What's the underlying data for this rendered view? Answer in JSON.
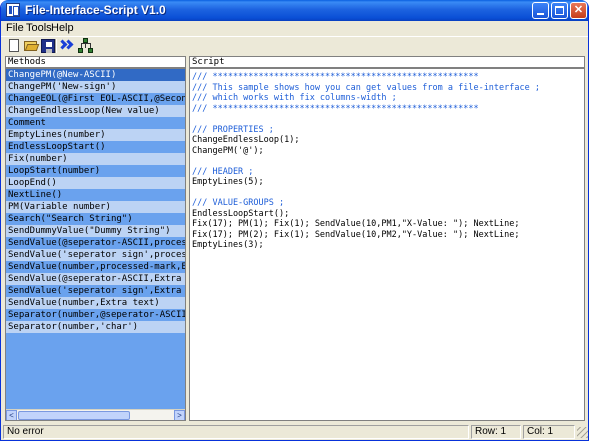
{
  "window": {
    "title": "File-Interface-Script V1.0",
    "titlebar_buttons": [
      "minimize",
      "maximize",
      "close"
    ],
    "close_glyph": "✕"
  },
  "menu": [
    "File",
    "Tools",
    "Help"
  ],
  "toolbar": {
    "tools": [
      "new-file-icon",
      "open-folder-icon",
      "save-disk-icon",
      "double-chevron-right-icon",
      "network-tree-icon"
    ]
  },
  "methods": {
    "header": "Methods",
    "items": [
      "ChangePM(@New-ASCII)",
      "ChangePM('New-sign')",
      "ChangeEOL(@First EOL-ASCII,@Secon",
      "ChangeEndlessLoop(New value)",
      "Comment",
      "EmptyLines(number)",
      "EndlessLoopStart()",
      "Fix(number)",
      "LoopStart(number)",
      "LoopEnd()",
      "NextLine()",
      "PM(Variable number)",
      "Search(\"Search String\")",
      "SendDummyValue(\"Dummy String\")",
      "SendValue(@seperator-ASCII,proces",
      "SendValue('seperator sign',proces",
      "SendValue(number,processed-mark,E",
      "SendValue(@seperator-ASCII,Extra",
      "SendValue('seperator sign',Extra",
      "SendValue(number,Extra text)",
      "Separator(number,@seperator-ASCII",
      "Separator(number,'char')"
    ],
    "selected_index": 0,
    "scroll_arrows": {
      "left": "<",
      "right": ">"
    }
  },
  "script": {
    "header": "Script",
    "lines": [
      {
        "text": "/// ****************************************************",
        "kind": "comment"
      },
      {
        "text": "/// This sample shows how you can get values from a file-interface ;",
        "kind": "comment"
      },
      {
        "text": "/// which works with fix columns-width ;",
        "kind": "comment"
      },
      {
        "text": "/// ****************************************************",
        "kind": "comment"
      },
      {
        "text": "",
        "kind": "blank"
      },
      {
        "text": "/// PROPERTIES ;",
        "kind": "comment"
      },
      {
        "text": "ChangeEndlessLoop(1);",
        "kind": "code"
      },
      {
        "text": "ChangePM('@');",
        "kind": "code"
      },
      {
        "text": "",
        "kind": "blank"
      },
      {
        "text": "/// HEADER ;",
        "kind": "comment"
      },
      {
        "text": "EmptyLines(5);",
        "kind": "code"
      },
      {
        "text": "",
        "kind": "blank"
      },
      {
        "text": "/// VALUE-GROUPS ;",
        "kind": "comment"
      },
      {
        "text": "EndlessLoopStart();",
        "kind": "code"
      },
      {
        "text": "Fix(17); PM(1); Fix(1); SendValue(10,PM1,\"X-Value: \"); NextLine;",
        "kind": "code"
      },
      {
        "text": "Fix(17); PM(2); Fix(1); SendValue(10,PM2,\"Y-Value: \"); NextLine;",
        "kind": "code"
      },
      {
        "text": "EmptyLines(3);",
        "kind": "code"
      }
    ]
  },
  "status": {
    "message": "No error",
    "row": "Row: 1",
    "col": "Col: 1"
  },
  "colors": {
    "accent": "#316ac5",
    "list_odd": "#6aa2ee",
    "list_even": "#bcd3f4",
    "comment": "#1e5ed8"
  }
}
